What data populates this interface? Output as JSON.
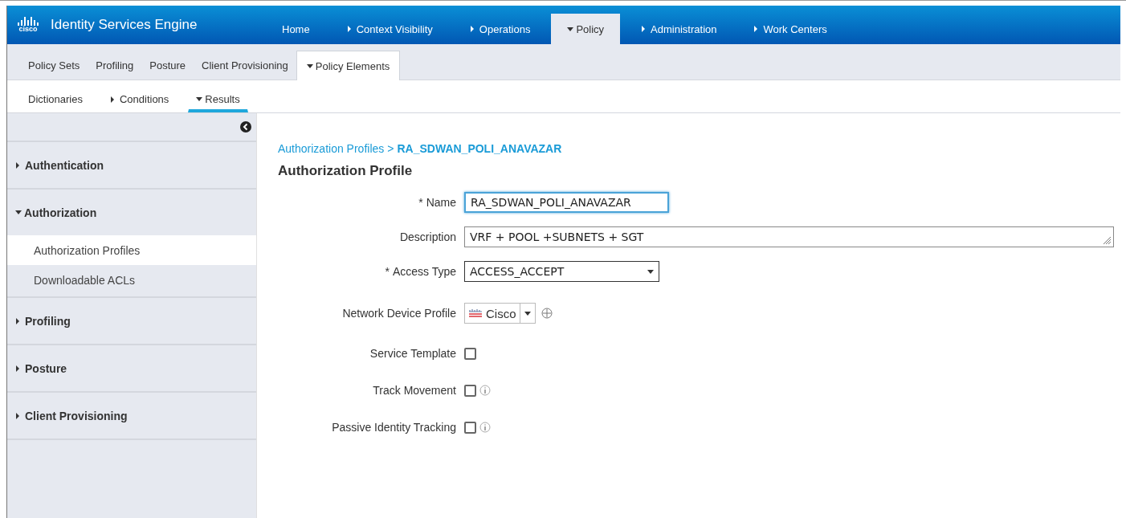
{
  "header": {
    "logo_text": "cisco",
    "product": "Identity Services Engine",
    "tabs": [
      {
        "label": "Home",
        "kind": "link",
        "selected": false
      },
      {
        "label": "Context Visibility",
        "kind": "menu",
        "expanded": false,
        "selected": false
      },
      {
        "label": "Operations",
        "kind": "menu",
        "expanded": false,
        "selected": false
      },
      {
        "label": "Policy",
        "kind": "menu",
        "expanded": true,
        "selected": true
      },
      {
        "label": "Administration",
        "kind": "menu",
        "expanded": false,
        "selected": false
      },
      {
        "label": "Work Centers",
        "kind": "menu",
        "expanded": false,
        "selected": false
      }
    ]
  },
  "subnav": [
    {
      "label": "Policy Sets",
      "kind": "link",
      "selected": false
    },
    {
      "label": "Profiling",
      "kind": "link",
      "selected": false
    },
    {
      "label": "Posture",
      "kind": "link",
      "selected": false
    },
    {
      "label": "Client Provisioning",
      "kind": "link",
      "selected": false
    },
    {
      "label": "Policy Elements",
      "kind": "menu",
      "expanded": true,
      "selected": true
    }
  ],
  "subsubnav": [
    {
      "label": "Dictionaries",
      "kind": "link",
      "selected": false
    },
    {
      "label": "Conditions",
      "kind": "menu",
      "expanded": false,
      "selected": false
    },
    {
      "label": "Results",
      "kind": "menu",
      "expanded": true,
      "selected": true
    }
  ],
  "sidebar": {
    "items": [
      {
        "label": "Authentication",
        "expanded": false
      },
      {
        "label": "Authorization",
        "expanded": true,
        "children": [
          {
            "label": "Authorization Profiles",
            "selected": true
          },
          {
            "label": "Downloadable ACLs",
            "selected": false
          }
        ]
      },
      {
        "label": "Profiling",
        "expanded": false
      },
      {
        "label": "Posture",
        "expanded": false
      },
      {
        "label": "Client Provisioning",
        "expanded": false
      }
    ]
  },
  "breadcrumb": {
    "parent": "Authorization Profiles",
    "separator": ">",
    "current": "RA_SDWAN_POLI_ANAVAZAR"
  },
  "title": "Authorization Profile",
  "form": [
    {
      "kind": "text",
      "required_mark": "*",
      "label": "Name",
      "value": "RA_SDWAN_POLI_ANAVAZAR",
      "focused": true
    },
    {
      "kind": "textarea",
      "label": "Description",
      "value": "VRF + POOL +SUBNETS + SGT",
      "focused": false
    },
    {
      "kind": "select",
      "required_mark": "*",
      "label": "Access Type",
      "value": "ACCESS_ACCEPT",
      "focused": false
    },
    {
      "kind": "device_profile",
      "label": "Network Device Profile",
      "value": "Cisco"
    },
    {
      "kind": "checkbox",
      "label": "Service Template",
      "checked": false,
      "info": false
    },
    {
      "kind": "checkbox",
      "label": "Track Movement",
      "checked": false,
      "info": true
    },
    {
      "kind": "checkbox",
      "label": "Passive Identity Tracking",
      "checked": false,
      "info": true
    }
  ]
}
